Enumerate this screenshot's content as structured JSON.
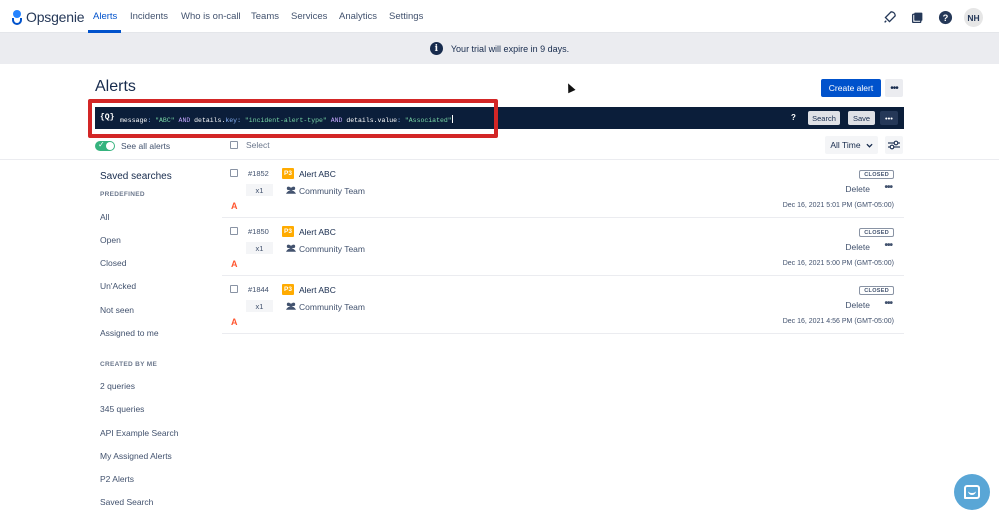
{
  "app": {
    "logo_text": "Opsgenie"
  },
  "nav": {
    "items": [
      {
        "label": "Alerts",
        "active": true
      },
      {
        "label": "Incidents"
      },
      {
        "label": "Who is on-call"
      },
      {
        "label": "Teams"
      },
      {
        "label": "Services"
      },
      {
        "label": "Analytics"
      },
      {
        "label": "Settings"
      }
    ],
    "icons": [
      "rocket-icon",
      "book-icon",
      "help-icon"
    ],
    "avatar_initials": "NH"
  },
  "banner": {
    "text": "Your trial will expire in 9 days.",
    "icon": "info-icon"
  },
  "header": {
    "title": "Alerts",
    "create_label": "Create alert",
    "more_label": "•••"
  },
  "search": {
    "query_icon": "{Q}",
    "query": {
      "f1": "message",
      "op1": ":",
      "v1": "\"ABC\"",
      "and1": "AND",
      "f2": "details",
      "dot2": ".",
      "k2": "key",
      "op2": ":",
      "v2": "\"incident-alert-type\"",
      "and2": "AND",
      "f3": "details",
      "dot3": ".",
      "k3": "value",
      "op3": ":",
      "v3": "\"Associated\""
    },
    "help_label": "?",
    "search_label": "Search",
    "save_label": "Save",
    "more_label": "•••"
  },
  "toolbar": {
    "see_all_label": "See all alerts",
    "see_all_on": true,
    "select_label": "Select",
    "time_range": "All Time"
  },
  "sidebar": {
    "title": "Saved searches",
    "predefined_label": "PREDEFINED",
    "predefined": [
      "All",
      "Open",
      "Closed",
      "Un'Acked",
      "Not seen",
      "Assigned to me"
    ],
    "created_label": "CREATED BY ME",
    "created": [
      "2 queries",
      "345 queries",
      "API Example Search",
      "My Assigned Alerts",
      "P2 Alerts",
      "Saved Search"
    ]
  },
  "alerts": [
    {
      "id": "#1852",
      "priority": "P3",
      "message": "Alert ABC",
      "count": "x1",
      "team": "Community Team",
      "ack": "A",
      "status": "CLOSED",
      "delete_label": "Delete",
      "more_label": "•••",
      "date": "Dec 16, 2021 5:01 PM (GMT-05:00)"
    },
    {
      "id": "#1850",
      "priority": "P3",
      "message": "Alert ABC",
      "count": "x1",
      "team": "Community Team",
      "ack": "A",
      "status": "CLOSED",
      "delete_label": "Delete",
      "more_label": "•••",
      "date": "Dec 16, 2021 5:00 PM (GMT-05:00)"
    },
    {
      "id": "#1844",
      "priority": "P3",
      "message": "Alert ABC",
      "count": "x1",
      "team": "Community Team",
      "ack": "A",
      "status": "CLOSED",
      "delete_label": "Delete",
      "more_label": "•••",
      "date": "Dec 16, 2021 4:56 PM (GMT-05:00)"
    }
  ],
  "colors": {
    "brand": "#0052cc",
    "searchbar_bg": "#0b1e3a",
    "highlight": "#d32626",
    "priority_p3": "#ffab00",
    "toggle_on": "#36b37e"
  }
}
